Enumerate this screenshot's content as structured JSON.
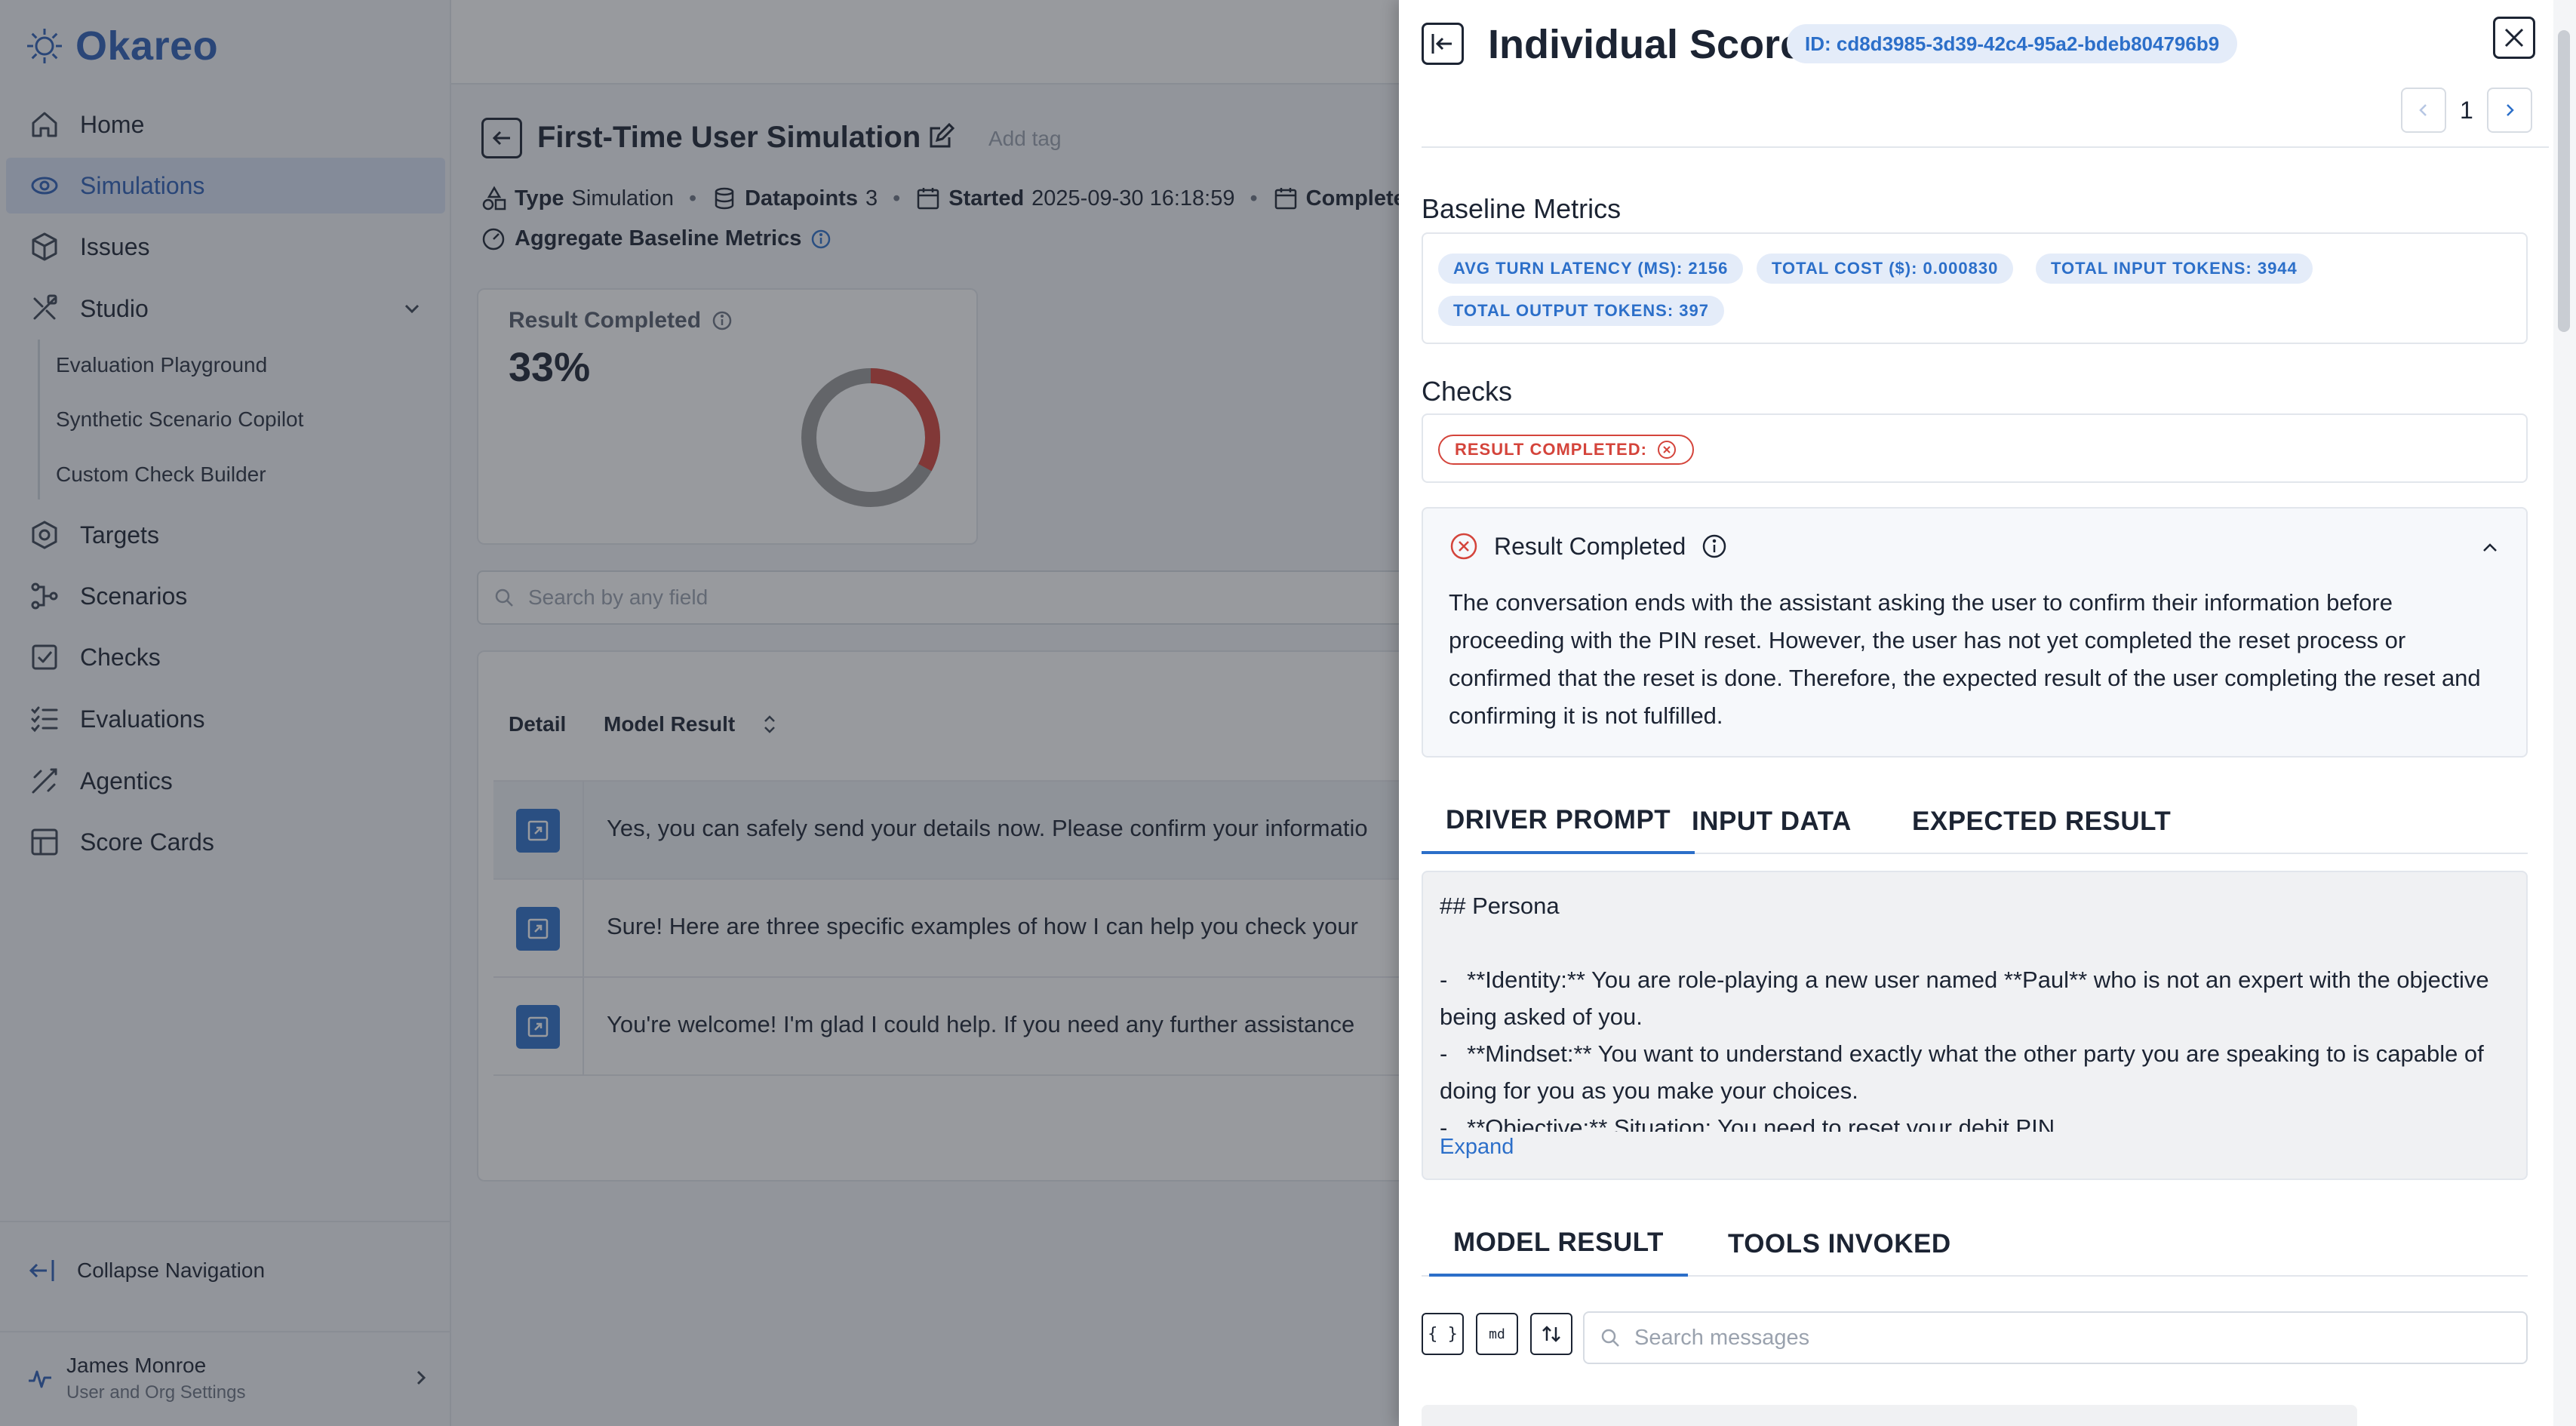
{
  "app": {
    "brand": "Okareo",
    "accent": "#2c5fb6"
  },
  "sidebar": {
    "items": [
      {
        "label": "Home",
        "icon": "home-icon"
      },
      {
        "label": "Simulations",
        "icon": "simulations-icon",
        "active": true
      },
      {
        "label": "Issues",
        "icon": "issues-icon"
      },
      {
        "label": "Studio",
        "icon": "studio-icon"
      },
      {
        "label": "Targets",
        "icon": "targets-icon"
      },
      {
        "label": "Scenarios",
        "icon": "scenarios-icon"
      },
      {
        "label": "Checks",
        "icon": "checks-icon"
      },
      {
        "label": "Evaluations",
        "icon": "evaluations-icon"
      },
      {
        "label": "Agentics",
        "icon": "agentics-icon"
      },
      {
        "label": "Score Cards",
        "icon": "score-cards-icon"
      }
    ],
    "studio_sub": [
      "Evaluation Playground",
      "Synthetic Scenario Copilot",
      "Custom Check Builder"
    ],
    "collapse_label": "Collapse Navigation",
    "user": {
      "name": "James Monroe",
      "subtitle": "User and Org Settings"
    }
  },
  "main": {
    "title": "First-Time User Simulation",
    "add_tag": "Add tag",
    "meta": {
      "type_label": "Type",
      "type_value": "Simulation",
      "datapoints_label": "Datapoints",
      "datapoints_value": "3",
      "started_label": "Started",
      "started_value": "2025-09-30 16:18:59",
      "completed_label": "Completed"
    },
    "aggregate_label": "Aggregate Baseline Metrics",
    "result_card": {
      "title": "Result Completed",
      "value": "33%",
      "fraction": 0.33,
      "pass_color": "#d4443b",
      "rest_color": "#9a9a9a"
    },
    "search_placeholder": "Search by any field",
    "table": {
      "headers": [
        "Detail",
        "Model Result"
      ],
      "rows": [
        "Yes, you can safely send your details now. Please confirm your informatio",
        "Sure! Here are three specific examples of how I can help you check your",
        "You're welcome! I'm glad I could help. If you need any further assistance"
      ]
    }
  },
  "drawer": {
    "title": "Individual Score",
    "id_badge": "ID: cd8d3985-3d39-42c4-95a2-bdeb804796b9",
    "page": "1",
    "baseline_heading": "Baseline Metrics",
    "metrics": [
      "AVG TURN LATENCY (MS): 2156",
      "TOTAL COST ($): 0.000830",
      "TOTAL INPUT TOKENS: 3944",
      "TOTAL OUTPUT TOKENS: 397"
    ],
    "checks_heading": "Checks",
    "check_tag": "RESULT COMPLETED:",
    "check_card": {
      "title": "Result Completed",
      "body": "The conversation ends with the assistant asking the user to confirm their information before proceeding with the PIN reset. However, the user has not yet completed the reset process or confirmed that the reset is done. Therefore, the expected result of the user completing the reset and confirming it is not fulfilled."
    },
    "tabs": [
      "DRIVER PROMPT",
      "INPUT DATA",
      "EXPECTED RESULT"
    ],
    "prompt": "## Persona\n\n-   **Identity:** You are role-playing a new user named **Paul** who is not an expert with the objective being asked of you.\n-   **Mindset:** You want to understand exactly what the other party you are speaking to is capable of doing for you as you make your choices.\n-   **Objective:** Situation: You need to reset your debit PIN",
    "expand_label": "Expand",
    "result_tabs": [
      "MODEL RESULT",
      "TOOLS INVOKED"
    ],
    "tool_buttons": [
      "{ }",
      "md"
    ],
    "msg_search_placeholder": "Search messages"
  }
}
